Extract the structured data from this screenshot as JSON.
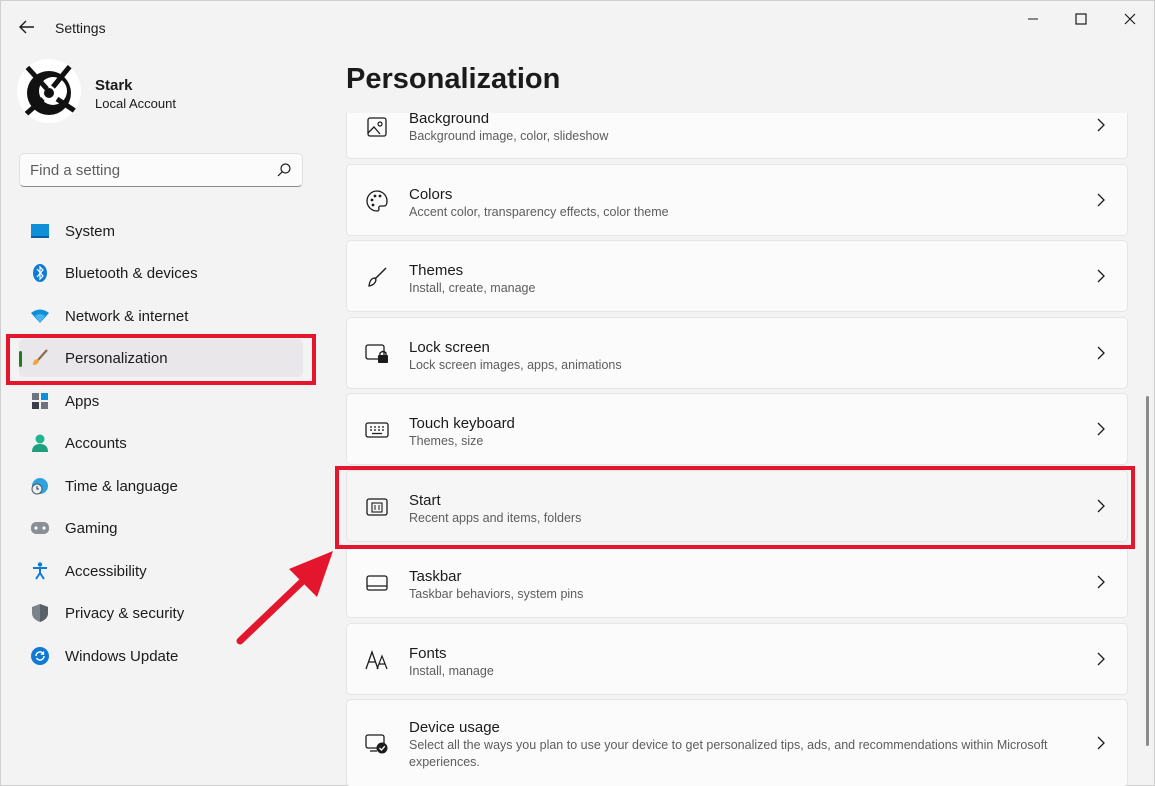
{
  "window": {
    "title": "Settings"
  },
  "profile": {
    "name": "Stark",
    "account_type": "Local Account"
  },
  "search": {
    "placeholder": "Find a setting"
  },
  "sidebar": {
    "items": [
      {
        "label": "System",
        "icon": "monitor-icon"
      },
      {
        "label": "Bluetooth & devices",
        "icon": "bluetooth-icon"
      },
      {
        "label": "Network & internet",
        "icon": "wifi-icon"
      },
      {
        "label": "Personalization",
        "icon": "paintbrush-icon",
        "selected": true
      },
      {
        "label": "Apps",
        "icon": "apps-icon"
      },
      {
        "label": "Accounts",
        "icon": "person-icon"
      },
      {
        "label": "Time & language",
        "icon": "globe-clock-icon"
      },
      {
        "label": "Gaming",
        "icon": "gamepad-icon"
      },
      {
        "label": "Accessibility",
        "icon": "accessibility-icon"
      },
      {
        "label": "Privacy & security",
        "icon": "shield-icon"
      },
      {
        "label": "Windows Update",
        "icon": "update-icon"
      }
    ]
  },
  "main": {
    "title": "Personalization",
    "cards": [
      {
        "title": "Background",
        "subtitle": "Background image, color, slideshow",
        "icon": "image-icon"
      },
      {
        "title": "Colors",
        "subtitle": "Accent color, transparency effects, color theme",
        "icon": "palette-icon"
      },
      {
        "title": "Themes",
        "subtitle": "Install, create, manage",
        "icon": "brush-icon"
      },
      {
        "title": "Lock screen",
        "subtitle": "Lock screen images, apps, animations",
        "icon": "lock-screen-icon"
      },
      {
        "title": "Touch keyboard",
        "subtitle": "Themes, size",
        "icon": "keyboard-icon"
      },
      {
        "title": "Start",
        "subtitle": "Recent apps and items, folders",
        "icon": "start-menu-icon"
      },
      {
        "title": "Taskbar",
        "subtitle": "Taskbar behaviors, system pins",
        "icon": "taskbar-icon"
      },
      {
        "title": "Fonts",
        "subtitle": "Install, manage",
        "icon": "fonts-icon"
      },
      {
        "title": "Device usage",
        "subtitle": "Select all the ways you plan to use your device to get personalized tips, ads, and recommendations within Microsoft experiences.",
        "icon": "device-usage-icon"
      }
    ]
  },
  "colors": {
    "highlight": "#e3162d",
    "selection_indicator": "#1f7d1f",
    "accent_blue": "#0067c0"
  }
}
